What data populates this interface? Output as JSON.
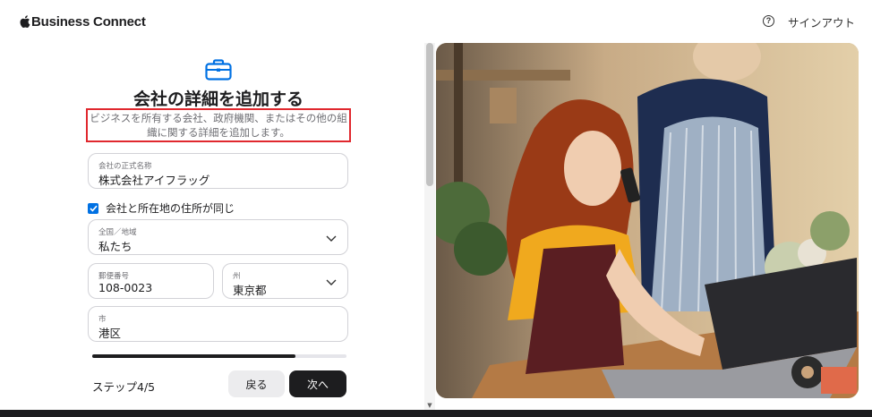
{
  "header": {
    "brand": "Business Connect",
    "help_icon": "?",
    "signout": "サインアウト"
  },
  "form": {
    "title": "会社の詳細を追加する",
    "subtitle_line1": "ビジネスを所有する会社、政府機関、またはその他の組",
    "subtitle_line2": "織に関する詳細を追加します。",
    "company_name": {
      "label": "会社の正式名称",
      "value": "株式会社アイフラッグ"
    },
    "same_address": {
      "label": "会社と所在地の住所が同じ",
      "checked": true
    },
    "country": {
      "label": "全国／地域",
      "value": "私たち"
    },
    "postal": {
      "label": "郵便番号",
      "value": "108-0023"
    },
    "state": {
      "label": "州",
      "value": "東京都"
    },
    "city": {
      "label": "市",
      "value": "港区"
    }
  },
  "footer": {
    "step": "ステップ4/5",
    "progress": 0.8,
    "back_label": "戻る",
    "next_label": "次へ"
  },
  "colors": {
    "accent": "#0071e3",
    "highlight_border": "#e0282e",
    "primary_button": "#1d1d1f"
  }
}
